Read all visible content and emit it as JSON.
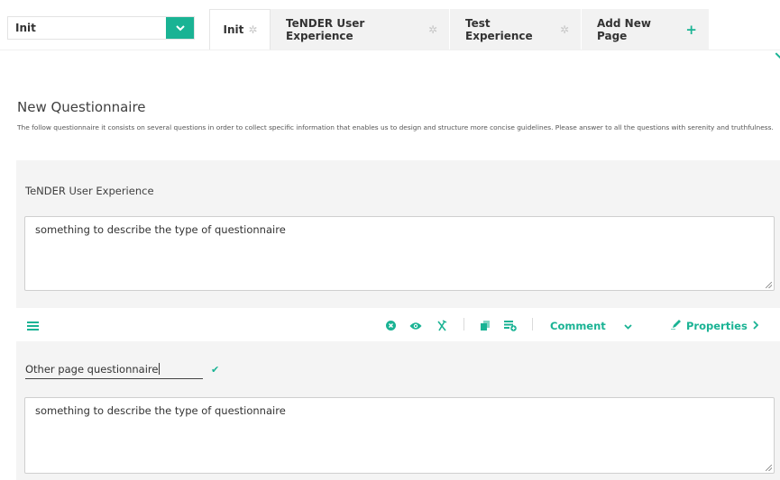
{
  "page_selector": {
    "value": "Init"
  },
  "tabs": [
    {
      "label": "Init",
      "icon": "gear-icon",
      "active": true
    },
    {
      "label": "TeNDER User Experience",
      "icon": "gear-icon",
      "active": false
    },
    {
      "label": "Test Experience",
      "icon": "gear-icon",
      "active": false
    },
    {
      "label": "Add New Page",
      "icon": "plus-icon",
      "active": false
    }
  ],
  "questionnaire": {
    "title": "New Questionnaire",
    "description": "The follow questionnaire it consists on several questions in order to collect specific information that enables us to design and structure more concise guidelines. Please answer to all the questions with serenity and truthfulness."
  },
  "pages": [
    {
      "title": "TeNDER User Experience",
      "description": "something to describe the type of questionnaire"
    },
    {
      "title": "Other page questionnaire",
      "description": "something to describe the type of questionnaire"
    }
  ],
  "toolbar": {
    "comment_label": "Comment",
    "properties_label": "Properties"
  },
  "colors": {
    "accent": "#1ab394",
    "panel_bg": "#f4f4f4"
  }
}
